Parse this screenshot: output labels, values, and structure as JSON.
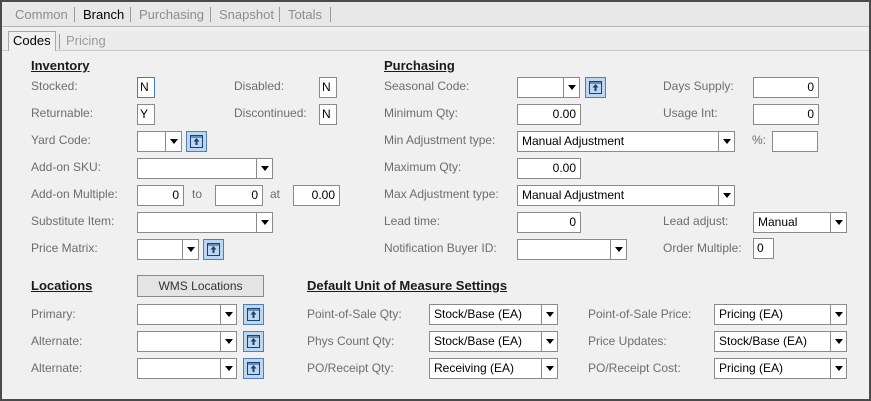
{
  "tabs": [
    "Common",
    "Branch",
    "Purchasing",
    "Snapshot",
    "Totals"
  ],
  "subtabs": [
    "Codes",
    "Pricing"
  ],
  "inventory": {
    "header": "Inventory",
    "stocked_label": "Stocked:",
    "stocked_value": "N",
    "disabled_label": "Disabled:",
    "disabled_value": "N",
    "returnable_label": "Returnable:",
    "returnable_value": "Y",
    "discontinued_label": "Discontinued:",
    "discontinued_value": "N",
    "yard_code_label": "Yard Code:",
    "yard_code_value": "",
    "addon_sku_label": "Add-on SKU:",
    "addon_sku_value": "",
    "addon_multiple_label": "Add-on Multiple:",
    "addon_multiple_from": "0",
    "to_label": "to",
    "addon_multiple_to": "0",
    "at_label": "at",
    "addon_multiple_at": "0.00",
    "substitute_label": "Substitute Item:",
    "substitute_value": "",
    "price_matrix_label": "Price Matrix:",
    "price_matrix_value": ""
  },
  "purchasing": {
    "header": "Purchasing",
    "seasonal_code_label": "Seasonal Code:",
    "seasonal_code_value": "",
    "days_supply_label": "Days Supply:",
    "days_supply_value": "0",
    "min_qty_label": "Minimum Qty:",
    "min_qty_value": "0.00",
    "usage_int_label": "Usage Int:",
    "usage_int_value": "0",
    "min_adj_label": "Min Adjustment type:",
    "min_adj_value": "Manual Adjustment",
    "percent_label": "%:",
    "percent_value": "",
    "max_qty_label": "Maximum Qty:",
    "max_qty_value": "0.00",
    "max_adj_label": "Max Adjustment type:",
    "max_adj_value": "Manual Adjustment",
    "lead_time_label": "Lead time:",
    "lead_time_value": "0",
    "lead_adjust_label": "Lead adjust:",
    "lead_adjust_value": "Manual",
    "buyer_label": "Notification Buyer ID:",
    "buyer_value": "",
    "order_multiple_label": "Order Multiple:",
    "order_multiple_value": "0"
  },
  "locations": {
    "header": "Locations",
    "wms_button": "WMS Locations",
    "primary_label": "Primary:",
    "primary_value": "",
    "alternate1_label": "Alternate:",
    "alternate1_value": "",
    "alternate2_label": "Alternate:",
    "alternate2_value": ""
  },
  "uom": {
    "header": "Default Unit of Measure Settings",
    "pos_qty_label": "Point-of-Sale Qty:",
    "pos_qty_value": "Stock/Base (EA)",
    "phys_count_label": "Phys Count Qty:",
    "phys_count_value": "Stock/Base (EA)",
    "po_receipt_qty_label": "PO/Receipt Qty:",
    "po_receipt_qty_value": "Receiving (EA)",
    "pos_price_label": "Point-of-Sale Price:",
    "pos_price_value": "Pricing (EA)",
    "price_updates_label": "Price Updates:",
    "price_updates_value": "Stock/Base (EA)",
    "po_receipt_cost_label": "PO/Receipt Cost:",
    "po_receipt_cost_value": "Pricing (EA)"
  },
  "icons": {
    "dropdown": "chevron-down-icon",
    "lookup": "lookup-icon"
  }
}
